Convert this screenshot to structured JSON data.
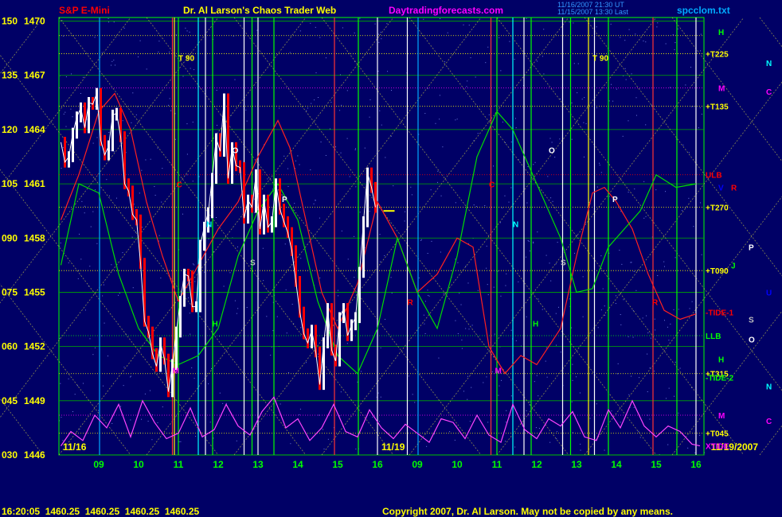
{
  "header": {
    "instrument": "S&P E-Mini",
    "web_title": "Dr. Al Larson's Chaos Trader Web",
    "site": "Daytradingforecasts.com",
    "timestamp_line1": "11/16/2007 21:30 UT",
    "timestamp_line2": "11/15/2007 13:30 Last",
    "file": "spcclom.txt"
  },
  "footer": {
    "quote": "16:20:05  1460.25  1460.25  1460.25  1460.25",
    "copyright": "Copyright 2007, Dr. Al Larson. May not be copied by any means."
  },
  "chart_data": {
    "type": "line",
    "title": "S&P E-Mini",
    "y_ticks": [
      {
        "left": "150",
        "right": "1470",
        "price": 1470
      },
      {
        "left": "135",
        "right": "1467",
        "price": 1467
      },
      {
        "left": "120",
        "right": "1464",
        "price": 1464
      },
      {
        "left": "105",
        "right": "1461",
        "price": 1461
      },
      {
        "left": "090",
        "right": "1458",
        "price": 1458
      },
      {
        "left": "075",
        "right": "1455",
        "price": 1455
      },
      {
        "left": "060",
        "right": "1452",
        "price": 1452
      },
      {
        "left": "045",
        "right": "1449",
        "price": 1449
      },
      {
        "left": "030",
        "right": "1446",
        "price": 1446
      }
    ],
    "ylim": [
      1446,
      1470.2
    ],
    "xlim": [
      8.0,
      24.2
    ],
    "x_ticks": [
      {
        "label": "09",
        "x": 9
      },
      {
        "label": "10",
        "x": 10
      },
      {
        "label": "11",
        "x": 11
      },
      {
        "label": "12",
        "x": 12
      },
      {
        "label": "13",
        "x": 13
      },
      {
        "label": "14",
        "x": 14
      },
      {
        "label": "15",
        "x": 15
      },
      {
        "label": "16",
        "x": 16
      },
      {
        "label": "09",
        "x": 17
      },
      {
        "label": "10",
        "x": 18
      },
      {
        "label": "11",
        "x": 19
      },
      {
        "label": "12",
        "x": 20
      },
      {
        "label": "13",
        "x": 21
      },
      {
        "label": "14",
        "x": 22
      },
      {
        "label": "15",
        "x": 23
      },
      {
        "label": "16",
        "x": 24
      }
    ],
    "date_labels": [
      {
        "text": "11/16",
        "x": 8.1
      },
      {
        "text": "11/19",
        "x": 16.1
      },
      {
        "text": "11/19/2007",
        "x": 24.1
      }
    ],
    "right_labels": [
      {
        "text": "H",
        "price": 1469.4,
        "color": "#00ff00"
      },
      {
        "text": "T225",
        "price": 1468.2,
        "color": "#ffff00"
      },
      {
        "text": "N",
        "price": 1467.7,
        "color": "#00ffff"
      },
      {
        "text": "M",
        "price": 1466.3,
        "color": "#ff00ff"
      },
      {
        "text": "C",
        "price": 1466.1,
        "color": "#ff00ff"
      },
      {
        "text": "T135",
        "price": 1465.3,
        "color": "#ffff00"
      },
      {
        "text": "ULB",
        "price": 1461.5,
        "color": "#ff0000"
      },
      {
        "text": "V",
        "price": 1460.8,
        "color": "#0000ff"
      },
      {
        "text": "R",
        "price": 1460.8,
        "color": "#ff0000"
      },
      {
        "text": "T270",
        "price": 1459.7,
        "color": "#ffff00"
      },
      {
        "text": "P",
        "price": 1457.5,
        "color": "#ffffff"
      },
      {
        "text": "J",
        "price": 1456.5,
        "color": "#00ff00"
      },
      {
        "text": "T090",
        "price": 1456.2,
        "color": "#ffff00"
      },
      {
        "text": "U",
        "price": 1455.0,
        "color": "#0000ff"
      },
      {
        "text": "-TIDE-1",
        "price": 1453.9,
        "color": "#ff0000"
      },
      {
        "text": "S",
        "price": 1453.5,
        "color": "#c0c0c0"
      },
      {
        "text": "LLB",
        "price": 1452.6,
        "color": "#00ff00"
      },
      {
        "text": "O",
        "price": 1452.4,
        "color": "#ffffff"
      },
      {
        "text": "H",
        "price": 1451.3,
        "color": "#00ff00"
      },
      {
        "text": "T315",
        "price": 1450.5,
        "color": "#ffff00"
      },
      {
        "text": "-TIDE-2",
        "price": 1450.3,
        "color": "#00ff00"
      },
      {
        "text": "N",
        "price": 1449.8,
        "color": "#00ffff"
      },
      {
        "text": "M",
        "price": 1448.2,
        "color": "#ff00ff"
      },
      {
        "text": "C",
        "price": 1447.9,
        "color": "#ff00ff"
      },
      {
        "text": "T045",
        "price": 1447.2,
        "color": "#ffff00"
      },
      {
        "text": "XTIDE",
        "price": 1446.5,
        "color": "#ff00ff"
      }
    ],
    "chart_markers": [
      {
        "text": "T 90",
        "x": 11.0,
        "price": 1467.8,
        "color": "#ffff00"
      },
      {
        "text": "T 90",
        "x": 21.4,
        "price": 1467.8,
        "color": "#ffff00"
      },
      {
        "text": "C",
        "x": 10.95,
        "price": 1460.8,
        "color": "#ff0000"
      },
      {
        "text": "C",
        "x": 18.8,
        "price": 1460.8,
        "color": "#ff0000"
      },
      {
        "text": "O",
        "x": 12.35,
        "price": 1462.7,
        "color": "#ffffff"
      },
      {
        "text": "O",
        "x": 20.3,
        "price": 1462.7,
        "color": "#ffffff"
      },
      {
        "text": "P",
        "x": 13.6,
        "price": 1460.0,
        "color": "#ffffff"
      },
      {
        "text": "P",
        "x": 21.9,
        "price": 1460.0,
        "color": "#ffffff"
      },
      {
        "text": "N",
        "x": 11.7,
        "price": 1458.6,
        "color": "#00ffff"
      },
      {
        "text": "N",
        "x": 19.4,
        "price": 1458.6,
        "color": "#00ffff"
      },
      {
        "text": "S",
        "x": 12.8,
        "price": 1456.5,
        "color": "#c0c0c0"
      },
      {
        "text": "S",
        "x": 20.6,
        "price": 1456.5,
        "color": "#c0c0c0"
      },
      {
        "text": "H",
        "x": 11.85,
        "price": 1453.1,
        "color": "#00ff00"
      },
      {
        "text": "H",
        "x": 19.9,
        "price": 1453.1,
        "color": "#00ff00"
      },
      {
        "text": "M",
        "x": 10.85,
        "price": 1450.5,
        "color": "#ff00ff"
      },
      {
        "text": "M",
        "x": 18.95,
        "price": 1450.5,
        "color": "#ff00ff"
      },
      {
        "text": "R",
        "x": 16.75,
        "price": 1454.3,
        "color": "#ff0000"
      },
      {
        "text": "R",
        "x": 22.9,
        "price": 1454.3,
        "color": "#ff0000"
      }
    ],
    "price_series": [
      [
        8.05,
        1463.3
      ],
      [
        8.15,
        1462.2
      ],
      [
        8.25,
        1462.5
      ],
      [
        8.35,
        1463.8
      ],
      [
        8.45,
        1464.7
      ],
      [
        8.55,
        1465.2
      ],
      [
        8.65,
        1464.1
      ],
      [
        8.75,
        1465.5
      ],
      [
        8.85,
        1465.4
      ],
      [
        8.95,
        1466.0
      ],
      [
        9.05,
        1463.4
      ],
      [
        9.15,
        1462.6
      ],
      [
        9.25,
        1463.1
      ],
      [
        9.35,
        1464.8
      ],
      [
        9.45,
        1464.9
      ],
      [
        9.55,
        1463.6
      ],
      [
        9.65,
        1461.0
      ],
      [
        9.75,
        1460.6
      ],
      [
        9.85,
        1459.3
      ],
      [
        9.95,
        1459.0
      ],
      [
        10.05,
        1456.6
      ],
      [
        10.15,
        1453.4
      ],
      [
        10.25,
        1452.8
      ],
      [
        10.35,
        1451.6
      ],
      [
        10.45,
        1450.9
      ],
      [
        10.55,
        1452.2
      ],
      [
        10.65,
        1451.3
      ],
      [
        10.75,
        1449.5
      ],
      [
        10.85,
        1451.0
      ],
      [
        10.95,
        1452.8
      ],
      [
        11.05,
        1454.5
      ],
      [
        11.15,
        1456.0
      ],
      [
        11.25,
        1455.9
      ],
      [
        11.35,
        1454.2
      ],
      [
        11.45,
        1454.2
      ],
      [
        11.55,
        1457.6
      ],
      [
        11.65,
        1458.6
      ],
      [
        11.75,
        1459.4
      ],
      [
        11.85,
        1461.3
      ],
      [
        11.95,
        1463.5
      ],
      [
        12.05,
        1462.8
      ],
      [
        12.15,
        1465.7
      ],
      [
        12.25,
        1461.3
      ],
      [
        12.35,
        1463.0
      ],
      [
        12.45,
        1462.0
      ],
      [
        12.55,
        1461.9
      ],
      [
        12.65,
        1459.1
      ],
      [
        12.75,
        1460.1
      ],
      [
        12.85,
        1459.7
      ],
      [
        12.95,
        1461.5
      ],
      [
        13.05,
        1458.5
      ],
      [
        13.15,
        1460.1
      ],
      [
        13.25,
        1458.6
      ],
      [
        13.35,
        1458.9
      ],
      [
        13.45,
        1461.0
      ],
      [
        13.55,
        1459.6
      ],
      [
        13.65,
        1458.9
      ],
      [
        13.75,
        1458.3
      ],
      [
        13.85,
        1457.3
      ],
      [
        13.95,
        1455.6
      ],
      [
        14.05,
        1453.9
      ],
      [
        14.15,
        1452.7
      ],
      [
        14.25,
        1452.2
      ],
      [
        14.35,
        1452.9
      ],
      [
        14.45,
        1451.7
      ],
      [
        14.55,
        1449.9
      ],
      [
        14.65,
        1452.2
      ],
      [
        14.75,
        1454.1
      ],
      [
        14.85,
        1451.8
      ],
      [
        14.95,
        1451.2
      ],
      [
        15.05,
        1453.6
      ],
      [
        15.15,
        1454.1
      ],
      [
        15.25,
        1452.6
      ],
      [
        15.35,
        1453.2
      ],
      [
        15.45,
        1453.6
      ],
      [
        15.55,
        1456.1
      ],
      [
        15.65,
        1458.9
      ],
      [
        15.75,
        1461.6
      ],
      [
        15.85,
        1460.8
      ],
      [
        15.95,
        1459.7
      ]
    ],
    "current_price_marker": {
      "x": 16.15,
      "price": 1459.5,
      "color": "#ffff00"
    },
    "vertical_lines": [
      {
        "x": 9.02,
        "color": "#00aaff"
      },
      {
        "x": 10.85,
        "color": "#ff3333"
      },
      {
        "x": 10.9,
        "color": "#ffff00"
      },
      {
        "x": 11.0,
        "color": "#00ff00"
      },
      {
        "x": 11.5,
        "color": "#00ffff"
      },
      {
        "x": 11.68,
        "color": "#ffffff"
      },
      {
        "x": 11.86,
        "color": "#00ff00"
      },
      {
        "x": 12.65,
        "color": "#ffffff"
      },
      {
        "x": 12.85,
        "color": "#00ff00"
      },
      {
        "x": 13.0,
        "color": "#ffffff"
      },
      {
        "x": 13.4,
        "color": "#00ff00"
      },
      {
        "x": 14.92,
        "color": "#ff3333"
      },
      {
        "x": 15.52,
        "color": "#00ff00"
      },
      {
        "x": 16.0,
        "color": "#ffffff"
      },
      {
        "x": 16.75,
        "color": "#ffffff"
      },
      {
        "x": 17.02,
        "color": "#00aaff"
      },
      {
        "x": 18.85,
        "color": "#ff3333"
      },
      {
        "x": 19.0,
        "color": "#00ff00"
      },
      {
        "x": 19.4,
        "color": "#00ffff"
      },
      {
        "x": 19.68,
        "color": "#ffffff"
      },
      {
        "x": 19.86,
        "color": "#00ff00"
      },
      {
        "x": 20.65,
        "color": "#ffffff"
      },
      {
        "x": 20.85,
        "color": "#00ff00"
      },
      {
        "x": 21.3,
        "color": "#ffff00"
      },
      {
        "x": 21.45,
        "color": "#ffffff"
      },
      {
        "x": 21.8,
        "color": "#00ff00"
      },
      {
        "x": 22.92,
        "color": "#ff3333"
      },
      {
        "x": 23.52,
        "color": "#00ff00"
      },
      {
        "x": 24.0,
        "color": "#ffffff"
      }
    ],
    "horizontal_levels": [
      {
        "price": 1469.2,
        "color": "#ffff00"
      },
      {
        "price": 1468.2,
        "color": "#ffff00"
      },
      {
        "price": 1466.3,
        "color": "#ff00ff"
      },
      {
        "price": 1465.3,
        "color": "#ffff00"
      },
      {
        "price": 1461.5,
        "color": "#ff0000"
      },
      {
        "price": 1459.7,
        "color": "#ffff00"
      },
      {
        "price": 1456.2,
        "color": "#ffff00"
      },
      {
        "price": 1452.6,
        "color": "#00ff00"
      },
      {
        "price": 1450.5,
        "color": "#ffff00"
      },
      {
        "price": 1448.2,
        "color": "#ff00ff"
      },
      {
        "price": 1447.2,
        "color": "#ffff00"
      }
    ],
    "red_wave": [
      [
        8.05,
        1459.0
      ],
      [
        8.5,
        1461.5
      ],
      [
        9.0,
        1465.0
      ],
      [
        9.4,
        1466.0
      ],
      [
        9.8,
        1464.0
      ],
      [
        10.2,
        1460.0
      ],
      [
        10.6,
        1457.0
      ],
      [
        11.0,
        1454.5
      ],
      [
        11.5,
        1456.5
      ],
      [
        12.0,
        1458.5
      ],
      [
        12.5,
        1460.0
      ],
      [
        13.0,
        1462.5
      ],
      [
        13.5,
        1464.5
      ],
      [
        13.8,
        1463.0
      ],
      [
        14.2,
        1459.0
      ],
      [
        14.6,
        1455.0
      ],
      [
        15.0,
        1453.0
      ],
      [
        15.5,
        1455.5
      ],
      [
        16.0,
        1460.0
      ],
      [
        16.5,
        1458.0
      ],
      [
        17.0,
        1455.0
      ],
      [
        17.5,
        1456.0
      ],
      [
        18.0,
        1458.0
      ],
      [
        18.4,
        1457.5
      ],
      [
        18.8,
        1452.0
      ],
      [
        19.2,
        1450.5
      ],
      [
        19.6,
        1451.5
      ],
      [
        20.0,
        1451.0
      ],
      [
        20.6,
        1453.0
      ],
      [
        21.0,
        1457.0
      ],
      [
        21.4,
        1460.5
      ],
      [
        21.7,
        1460.8
      ],
      [
        22.0,
        1460.0
      ],
      [
        22.4,
        1458.5
      ],
      [
        22.8,
        1456.0
      ],
      [
        23.2,
        1454.0
      ],
      [
        23.6,
        1453.5
      ],
      [
        24.0,
        1453.8
      ]
    ],
    "green_wave": [
      [
        8.05,
        1456.5
      ],
      [
        8.5,
        1461.0
      ],
      [
        9.0,
        1460.5
      ],
      [
        9.5,
        1456.0
      ],
      [
        10.0,
        1453.0
      ],
      [
        10.5,
        1451.5
      ],
      [
        11.0,
        1451.0
      ],
      [
        11.5,
        1451.5
      ],
      [
        12.0,
        1453.0
      ],
      [
        12.5,
        1457.0
      ],
      [
        13.0,
        1459.5
      ],
      [
        13.5,
        1461.0
      ],
      [
        14.0,
        1459.0
      ],
      [
        14.5,
        1454.5
      ],
      [
        15.0,
        1451.5
      ],
      [
        15.5,
        1450.5
      ],
      [
        16.0,
        1453.0
      ],
      [
        16.5,
        1458.0
      ],
      [
        17.0,
        1455.0
      ],
      [
        17.5,
        1453.0
      ],
      [
        18.0,
        1457.0
      ],
      [
        18.5,
        1462.5
      ],
      [
        19.0,
        1465.0
      ],
      [
        19.4,
        1464.0
      ],
      [
        19.8,
        1462.0
      ],
      [
        20.2,
        1460.0
      ],
      [
        20.6,
        1458.0
      ],
      [
        21.0,
        1455.0
      ],
      [
        21.4,
        1455.2
      ],
      [
        21.8,
        1457.5
      ],
      [
        22.2,
        1458.5
      ],
      [
        22.6,
        1459.5
      ],
      [
        23.0,
        1461.5
      ],
      [
        23.5,
        1460.8
      ],
      [
        24.0,
        1461.0
      ]
    ],
    "magenta_osc": [
      [
        8.05,
        1446.5
      ],
      [
        8.3,
        1447.3
      ],
      [
        8.6,
        1446.8
      ],
      [
        8.9,
        1448.2
      ],
      [
        9.2,
        1447.5
      ],
      [
        9.5,
        1448.8
      ],
      [
        9.8,
        1447.0
      ],
      [
        10.1,
        1449.0
      ],
      [
        10.4,
        1447.8
      ],
      [
        10.7,
        1446.9
      ],
      [
        11.0,
        1447.2
      ],
      [
        11.3,
        1448.6
      ],
      [
        11.6,
        1447.0
      ],
      [
        11.9,
        1447.4
      ],
      [
        12.2,
        1448.8
      ],
      [
        12.5,
        1447.6
      ],
      [
        12.8,
        1447.1
      ],
      [
        13.1,
        1448.4
      ],
      [
        13.4,
        1449.2
      ],
      [
        13.7,
        1447.5
      ],
      [
        14.0,
        1448.0
      ],
      [
        14.3,
        1446.8
      ],
      [
        14.6,
        1447.5
      ],
      [
        14.9,
        1448.8
      ],
      [
        15.2,
        1447.3
      ],
      [
        15.5,
        1447.0
      ],
      [
        15.8,
        1448.5
      ],
      [
        16.1,
        1447.5
      ],
      [
        16.4,
        1446.9
      ],
      [
        16.7,
        1447.7
      ],
      [
        17.0,
        1447.2
      ],
      [
        17.3,
        1446.7
      ],
      [
        17.6,
        1448.0
      ],
      [
        17.9,
        1447.8
      ],
      [
        18.2,
        1446.9
      ],
      [
        18.5,
        1448.2
      ],
      [
        18.8,
        1447.1
      ],
      [
        19.1,
        1446.7
      ],
      [
        19.4,
        1448.8
      ],
      [
        19.7,
        1447.4
      ],
      [
        20.0,
        1446.9
      ],
      [
        20.3,
        1448.0
      ],
      [
        20.6,
        1447.6
      ],
      [
        20.9,
        1448.4
      ],
      [
        21.2,
        1447.0
      ],
      [
        21.5,
        1446.8
      ],
      [
        21.8,
        1448.5
      ],
      [
        22.1,
        1447.5
      ],
      [
        22.4,
        1449.0
      ],
      [
        22.7,
        1447.6
      ],
      [
        23.0,
        1447.0
      ],
      [
        23.3,
        1447.6
      ],
      [
        23.6,
        1447.3
      ],
      [
        23.9,
        1446.6
      ],
      [
        24.1,
        1446.5
      ]
    ]
  }
}
